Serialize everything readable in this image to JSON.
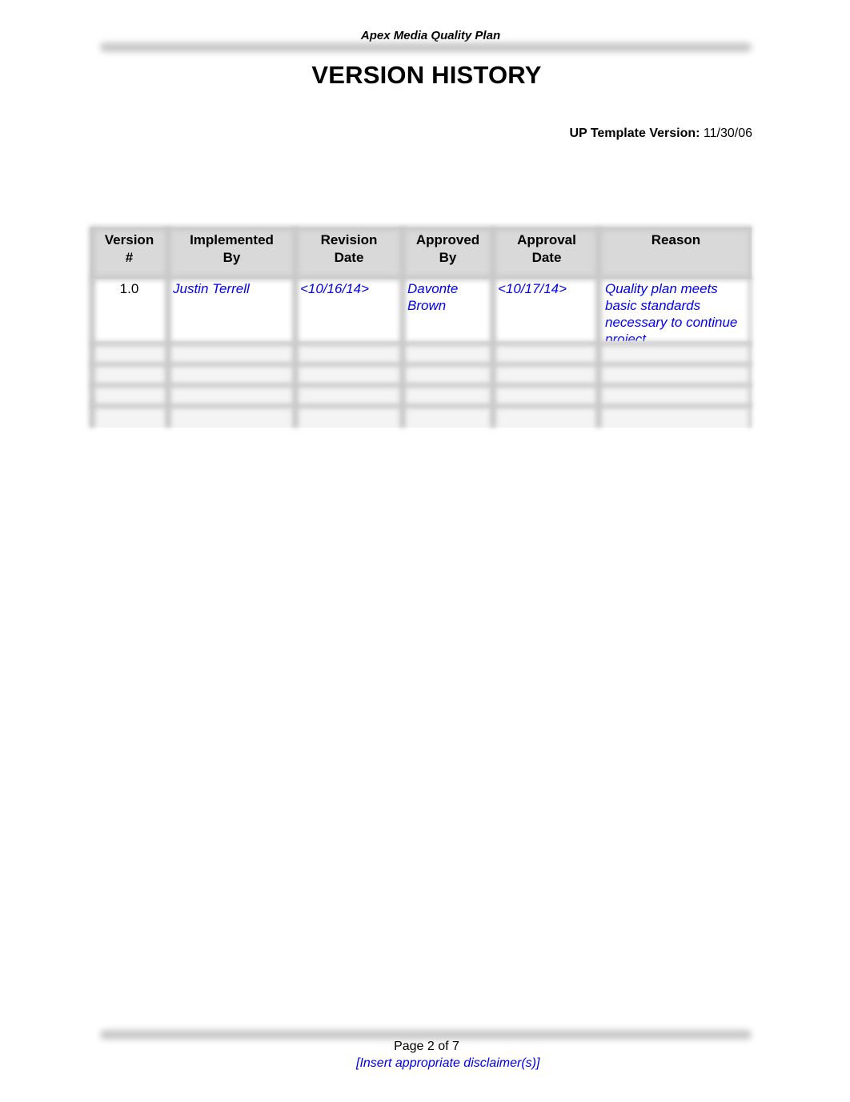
{
  "header": {
    "document_title": "Apex Media Quality Plan"
  },
  "page_title": "VERSION HISTORY",
  "template_version": {
    "label": "UP Template Version:",
    "value": "11/30/06"
  },
  "version_table": {
    "columns": [
      {
        "line1": "Version",
        "line2": "#"
      },
      {
        "line1": "Implemented",
        "line2": "By"
      },
      {
        "line1": "Revision",
        "line2": "Date"
      },
      {
        "line1": "Approved",
        "line2": "By"
      },
      {
        "line1": "Approval",
        "line2": "Date"
      },
      {
        "line1": "Reason",
        "line2": ""
      }
    ],
    "rows": [
      {
        "version": "1.0",
        "implemented_by": "Justin Terrell",
        "revision_date": "<10/16/14>",
        "approved_by": "Davonte Brown",
        "approval_date": "<10/17/14>",
        "reason": "Quality plan meets basic standards necessary to continue project"
      }
    ],
    "empty_row_count": 4
  },
  "footer": {
    "page_label": "Page 2 of 7",
    "disclaimer": "[Insert appropriate disclaimer(s)]"
  },
  "colors": {
    "placeholder_text": "#0000ee",
    "header_band": "#d9d9d9"
  }
}
